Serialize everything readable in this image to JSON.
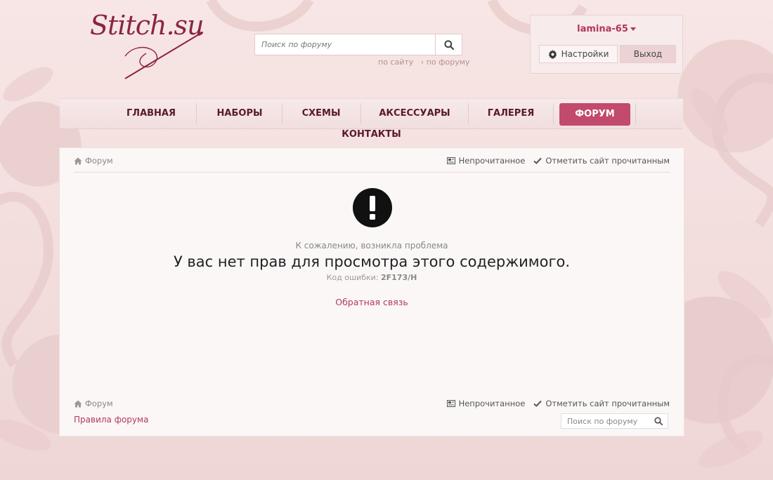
{
  "header": {
    "logo_text": "Stitch.su",
    "search": {
      "placeholder": "Поиск по форуму",
      "scope_site": "по сайту",
      "scope_forum": "по форуму"
    },
    "user": {
      "name": "lamina-65",
      "settings_label": "Настройки",
      "logout_label": "Выход"
    }
  },
  "nav": {
    "items": [
      {
        "label": "ГЛАВНАЯ"
      },
      {
        "label": "НАБОРЫ"
      },
      {
        "label": "СХЕМЫ"
      },
      {
        "label": "АКСЕССУАРЫ"
      },
      {
        "label": "ГАЛЕРЕЯ"
      },
      {
        "label": "ФОРУМ",
        "active": true
      },
      {
        "label": "КОНТАКТЫ"
      }
    ]
  },
  "content": {
    "breadcrumb": "Форум",
    "unread_label": "Непрочитанное",
    "mark_read_label": "Отметить сайт прочитанным",
    "sorry_text": "К сожалению, возникла проблема",
    "message": "У вас нет прав для просмотра этого содержимого.",
    "error_code_label": "Код ошибки:",
    "error_code": "2F173/H",
    "feedback_link": "Обратная связь",
    "rules_link": "Правила форума",
    "footer_search_placeholder": "Поиск по форуму"
  },
  "colors": {
    "accent": "#b23a5a",
    "nav_active": "#c24a6c",
    "nav_text": "#5a1a2c"
  },
  "icons": [
    "search-icon",
    "gear-icon",
    "home-icon",
    "newspaper-icon",
    "check-icon",
    "exclamation-circle-icon"
  ]
}
